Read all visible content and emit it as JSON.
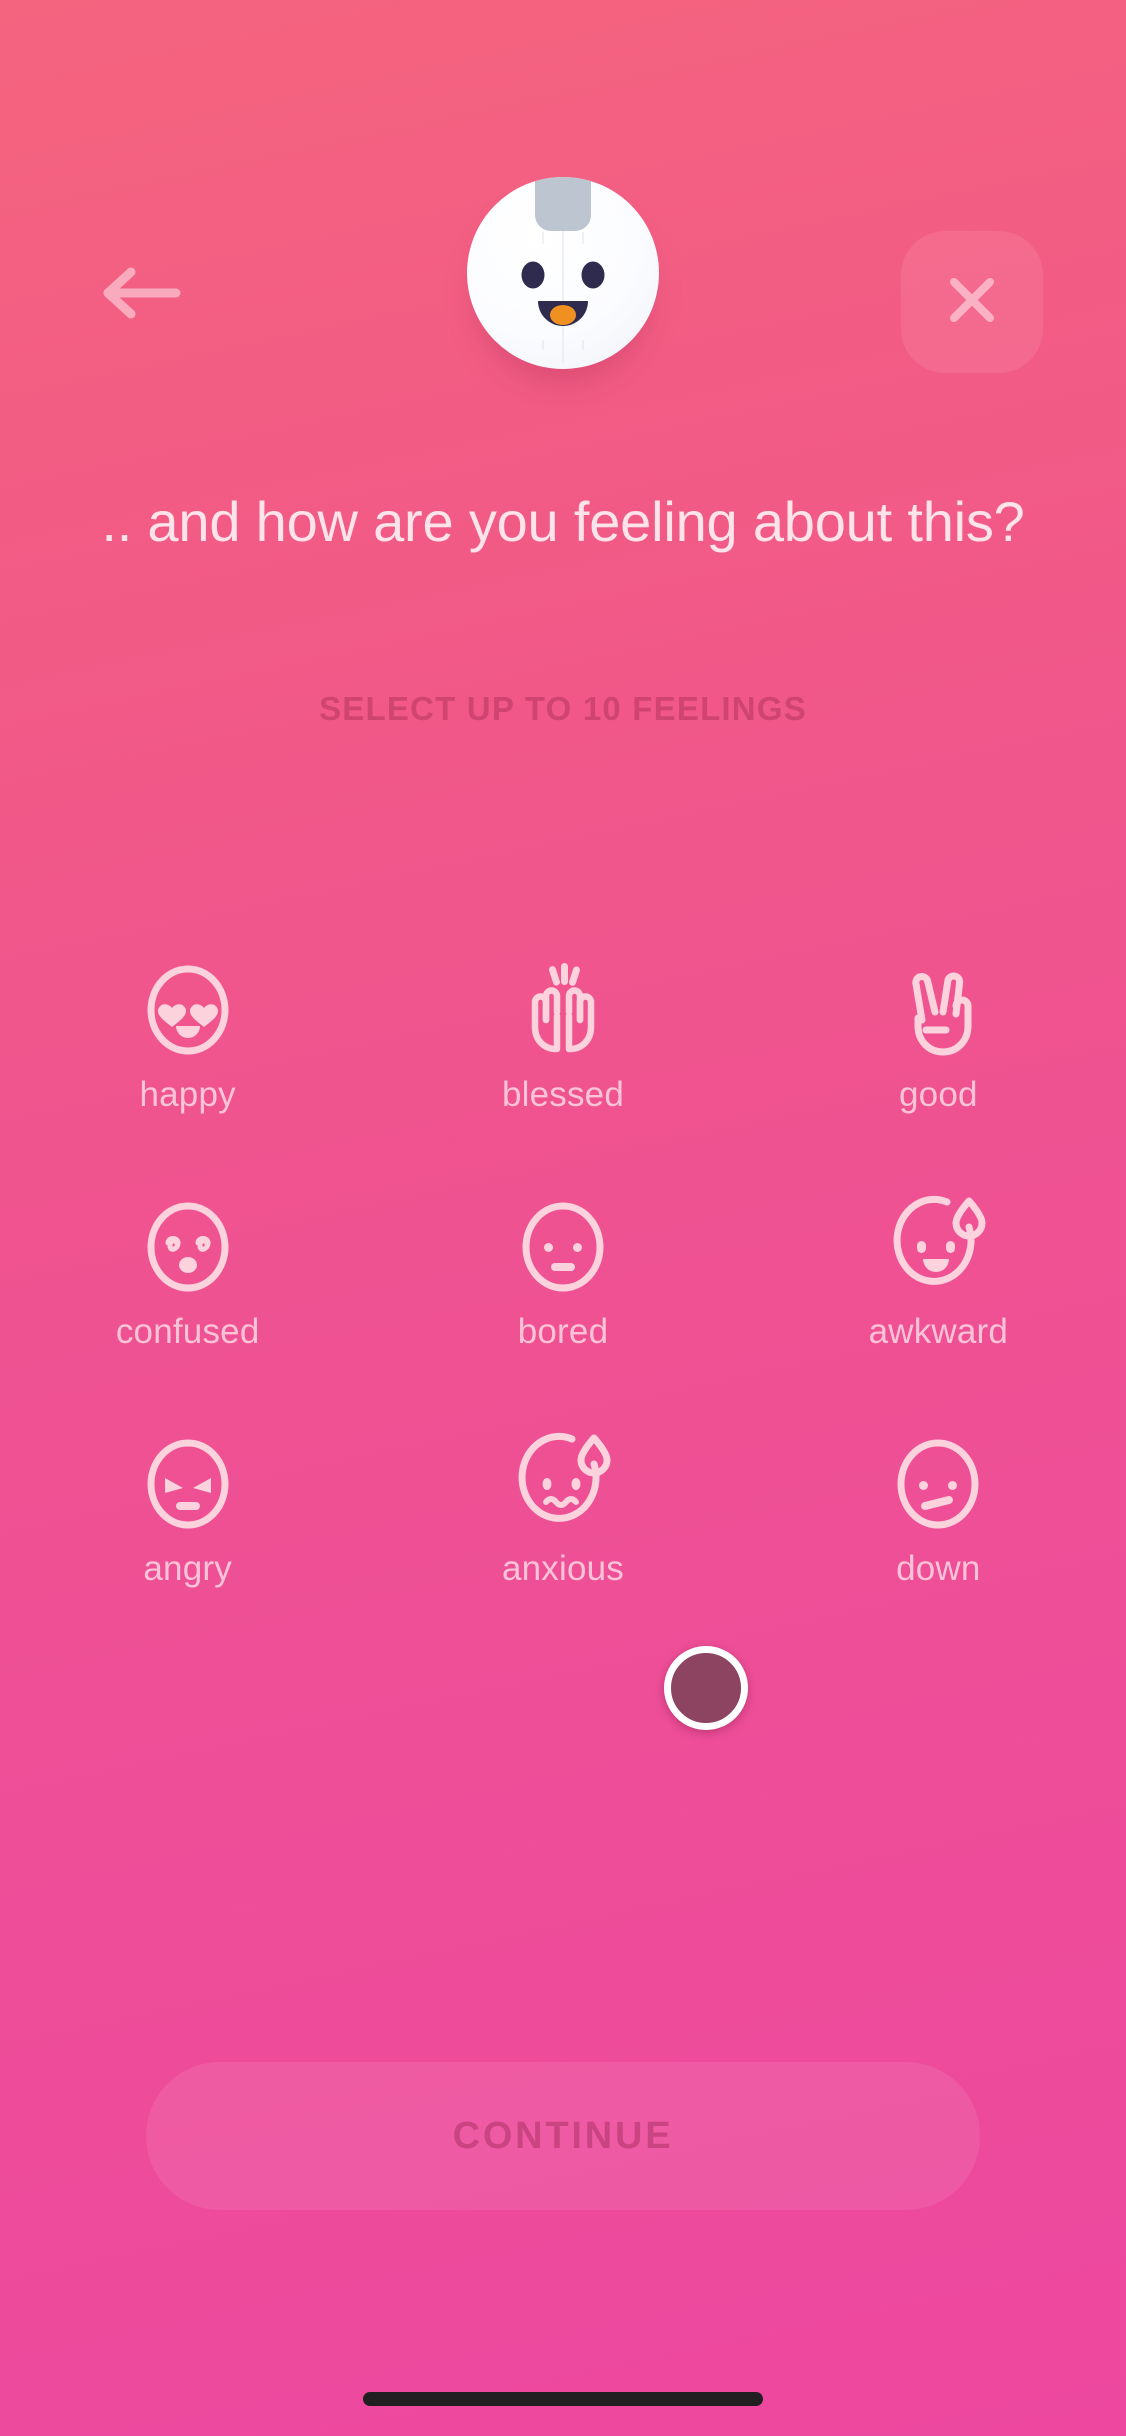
{
  "screen": {
    "background_top": "#f4647f",
    "background_bottom": "#ed479f"
  },
  "topbar": {
    "back_icon": "arrow-left-icon",
    "close_icon": "close-x-icon",
    "avatar_name": "penguin-avatar"
  },
  "header": {
    "title": ".. and how are you feeling about this?",
    "subtitle": "SELECT UP TO 10 FEELINGS"
  },
  "feelings": [
    {
      "label": "happy",
      "icon": "face-heart-eyes-icon",
      "selected": false
    },
    {
      "label": "blessed",
      "icon": "raising-hands-icon",
      "selected": false
    },
    {
      "label": "good",
      "icon": "victory-hand-icon",
      "selected": false
    },
    {
      "label": "confused",
      "icon": "face-spiral-eyes-icon",
      "selected": false
    },
    {
      "label": "bored",
      "icon": "face-neutral-icon",
      "selected": false
    },
    {
      "label": "awkward",
      "icon": "face-sweat-smile-icon",
      "selected": false
    },
    {
      "label": "angry",
      "icon": "face-angry-icon",
      "selected": false
    },
    {
      "label": "anxious",
      "icon": "face-anxious-sweat-icon",
      "selected": false
    },
    {
      "label": "down",
      "icon": "face-sad-icon",
      "selected": false
    }
  ],
  "footer": {
    "continue_label": "CONTINUE",
    "continue_enabled": false
  },
  "cursor": {
    "color": "#8c4460",
    "ring_color": "#ffffff"
  },
  "system": {
    "home_indicator": true
  }
}
